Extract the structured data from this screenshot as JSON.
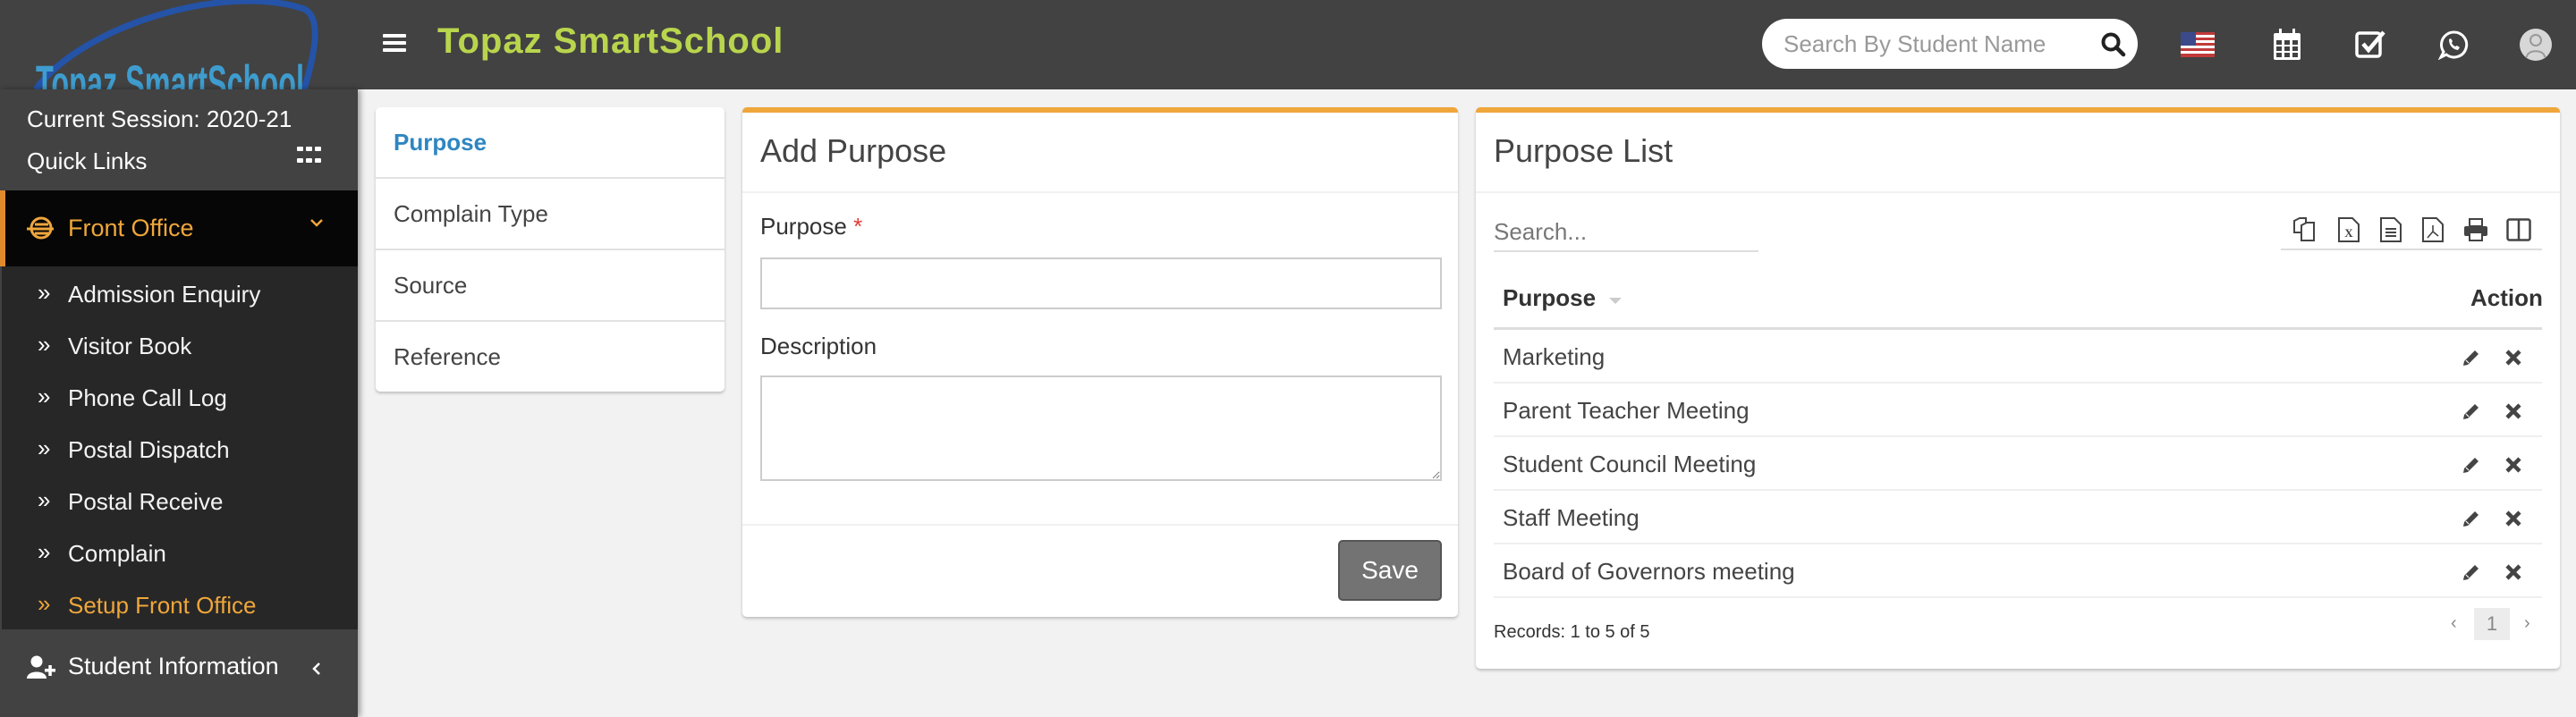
{
  "header": {
    "logo_text": "Topaz SmartSchool",
    "brand_title": "Topaz SmartSchool",
    "search_placeholder": "Search By Student Name",
    "icons": [
      "flag-us-icon",
      "calendar-icon",
      "task-checkbox-icon",
      "whatsapp-icon",
      "user-avatar-icon"
    ]
  },
  "sidebar": {
    "session": "Current Session: 2020-21",
    "quick_links": "Quick Links",
    "front_office": {
      "label": "Front Office",
      "icon": "front-office-icon",
      "expanded": true
    },
    "submenu": [
      {
        "label": "Admission Enquiry",
        "active": false
      },
      {
        "label": "Visitor Book",
        "active": false
      },
      {
        "label": "Phone Call Log",
        "active": false
      },
      {
        "label": "Postal Dispatch",
        "active": false
      },
      {
        "label": "Postal Receive",
        "active": false
      },
      {
        "label": "Complain",
        "active": false
      },
      {
        "label": "Setup Front Office",
        "active": true
      }
    ],
    "student_information": {
      "label": "Student Information",
      "icon": "user-plus-icon"
    }
  },
  "setup_menu": {
    "items": [
      {
        "label": "Purpose",
        "active": true
      },
      {
        "label": "Complain Type",
        "active": false
      },
      {
        "label": "Source",
        "active": false
      },
      {
        "label": "Reference",
        "active": false
      }
    ]
  },
  "add_form": {
    "title": "Add Purpose",
    "purpose_label": "Purpose",
    "required_mark": "*",
    "purpose_value": "",
    "description_label": "Description",
    "description_value": "",
    "save_label": "Save"
  },
  "purpose_list": {
    "title": "Purpose List",
    "search_placeholder": "Search...",
    "toolbar": [
      "copy-icon",
      "excel-icon",
      "csv-icon",
      "pdf-icon",
      "print-icon",
      "columns-icon"
    ],
    "columns": [
      "Purpose",
      "Action"
    ],
    "rows": [
      "Marketing",
      "Parent Teacher Meeting",
      "Student Council Meeting",
      "Staff Meeting",
      "Board of Governors meeting"
    ],
    "records_text": "Records: 1 to 5 of 5",
    "pagination": {
      "prev": "‹",
      "current": "1",
      "next": "›"
    }
  },
  "colors": {
    "header_bg": "#424242",
    "brand": "#b9d54d",
    "accent_orange": "#efa63b",
    "active_link_blue": "#2e86c1",
    "required_red": "#e53935"
  }
}
